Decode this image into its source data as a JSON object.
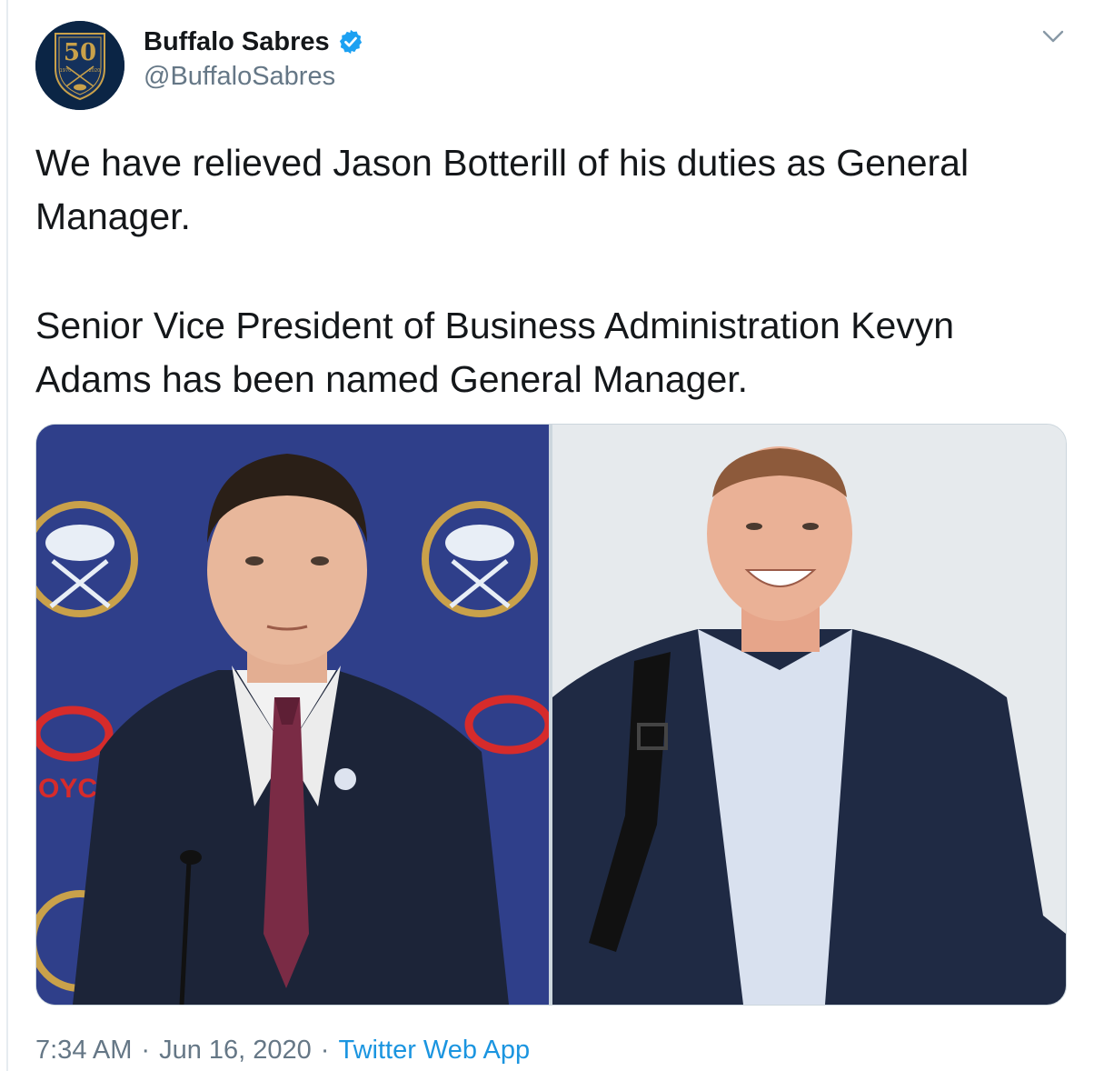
{
  "account": {
    "display_name": "Buffalo Sabres",
    "handle": "@BuffaloSabres",
    "verified": true,
    "avatar_icon": "sabres-50th-anniversary-logo",
    "avatar_text": "50",
    "avatar_years": [
      "1970",
      "2020"
    ]
  },
  "tweet": {
    "paragraphs": [
      "We have relieved Jason Botterill of his duties as General Manager.",
      "Senior Vice President of Business Administration Kevyn Adams has been named General Manager."
    ]
  },
  "media": {
    "photo_count": 2,
    "backdrop_text": "OYC"
  },
  "meta": {
    "time": "7:34 AM",
    "separator": "·",
    "date": "Jun 16, 2020",
    "source": "Twitter Web App"
  },
  "icons": {
    "verified": "verified-badge-icon",
    "menu": "chevron-down-icon"
  },
  "colors": {
    "text": "#14171a",
    "secondary": "#657786",
    "link": "#1b95e0",
    "verified": "#1da1f2",
    "sabres_navy": "#2c3e86",
    "sabres_gold": "#fcb514"
  }
}
